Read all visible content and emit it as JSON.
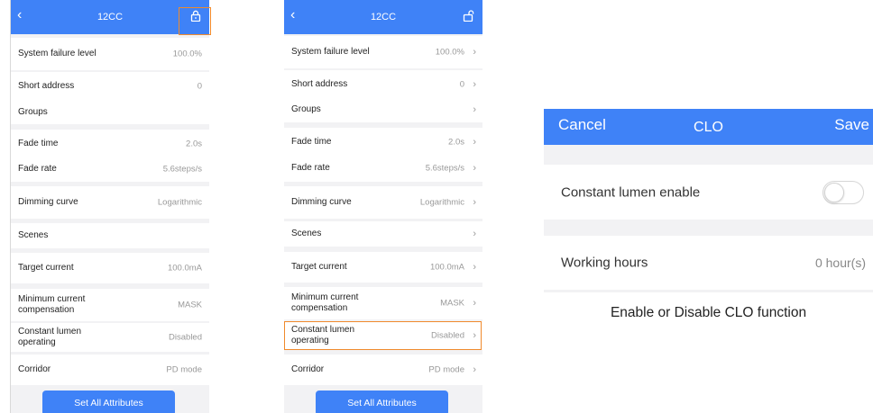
{
  "colors": {
    "accent": "#3f82f7",
    "highlight": "#f08a2c"
  },
  "screen1": {
    "back_icon": "chevron-left-icon",
    "title": "12CC",
    "lock_icon": "lock-closed-icon",
    "rows": [
      {
        "label": "System failure level",
        "value": "100.0%"
      },
      {
        "label": "Short address",
        "value": "0"
      },
      {
        "label": "Groups",
        "value": ""
      },
      {
        "label": "Fade time",
        "value": "2.0s"
      },
      {
        "label": "Fade rate",
        "value": "5.6steps/s"
      },
      {
        "label": "Dimming curve",
        "value": "Logarithmic"
      },
      {
        "label": "Scenes",
        "value": ""
      },
      {
        "label": "Target current",
        "value": "100.0mA"
      },
      {
        "label": "Minimum current compensation",
        "value": "MASK"
      },
      {
        "label": "Constant lumen operating",
        "value": "Disabled"
      },
      {
        "label": "Corridor",
        "value": "PD mode"
      }
    ],
    "button": "Set All Attributes"
  },
  "screen2": {
    "back_icon": "chevron-left-icon",
    "title": "12CC",
    "lock_icon": "lock-open-icon",
    "rows": [
      {
        "label": "System failure level",
        "value": "100.0%"
      },
      {
        "label": "Short address",
        "value": "0"
      },
      {
        "label": "Groups",
        "value": ""
      },
      {
        "label": "Fade time",
        "value": "2.0s"
      },
      {
        "label": "Fade rate",
        "value": "5.6steps/s"
      },
      {
        "label": "Dimming curve",
        "value": "Logarithmic"
      },
      {
        "label": "Scenes",
        "value": ""
      },
      {
        "label": "Target current",
        "value": "100.0mA"
      },
      {
        "label": "Minimum current compensation",
        "value": "MASK"
      },
      {
        "label": "Constant lumen operating",
        "value": "Disabled"
      },
      {
        "label": "Corridor",
        "value": "PD mode"
      }
    ],
    "button": "Set All Attributes"
  },
  "clo": {
    "cancel": "Cancel",
    "title": "CLO",
    "save": "Save",
    "enable_label": "Constant lumen enable",
    "enable_state": "off",
    "hours_label": "Working hours",
    "hours_value": "0 hour(s)"
  },
  "caption": "Enable or Disable CLO function"
}
